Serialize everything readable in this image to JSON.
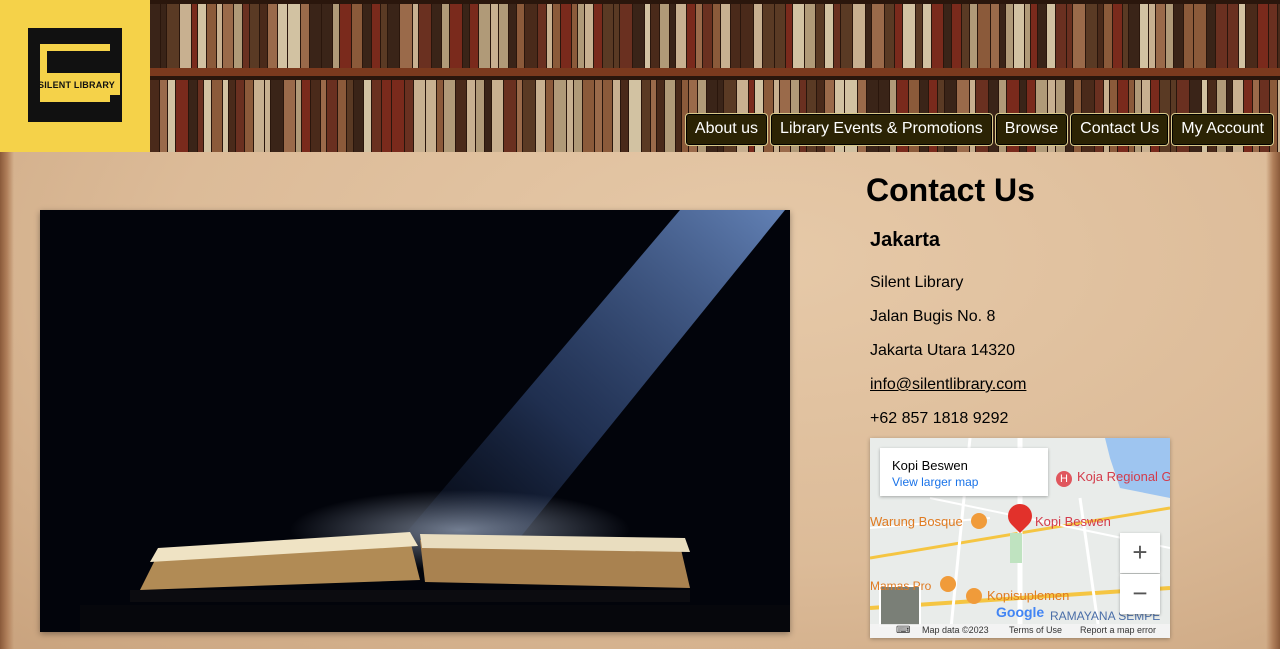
{
  "logo": {
    "text": "SILENT LIBRARY",
    "brand_color": "#f5d249"
  },
  "nav": {
    "items": [
      {
        "label": "About us"
      },
      {
        "label": "Library Events & Promotions"
      },
      {
        "label": "Browse"
      },
      {
        "label": "Contact Us"
      },
      {
        "label": "My Account"
      }
    ]
  },
  "contact": {
    "title": "Contact Us",
    "city": "Jakarta",
    "lines": {
      "name": "Silent Library",
      "street": "Jalan Bugis No. 8",
      "postal": "Jakarta Utara 14320",
      "email": "info@silentlibrary.com",
      "phone": "+62 857 1818 9292"
    }
  },
  "map": {
    "place": "Kopi Beswen",
    "view_link": "View larger map",
    "labels": {
      "hospital": "Koja Regional General Hospit",
      "warung": "Warung Bosque",
      "pin": "Kopi Beswen",
      "kopisuplemen": "Kopisuplemen",
      "mamaspro": "Mamas Pro",
      "ramayana": "RAMAYANA SEMPE",
      "google": "Google"
    },
    "zoom_in": "+",
    "zoom_out": "−",
    "footer": {
      "data": "Map data ©2023",
      "terms": "Terms of Use",
      "report": "Report a map error"
    }
  }
}
